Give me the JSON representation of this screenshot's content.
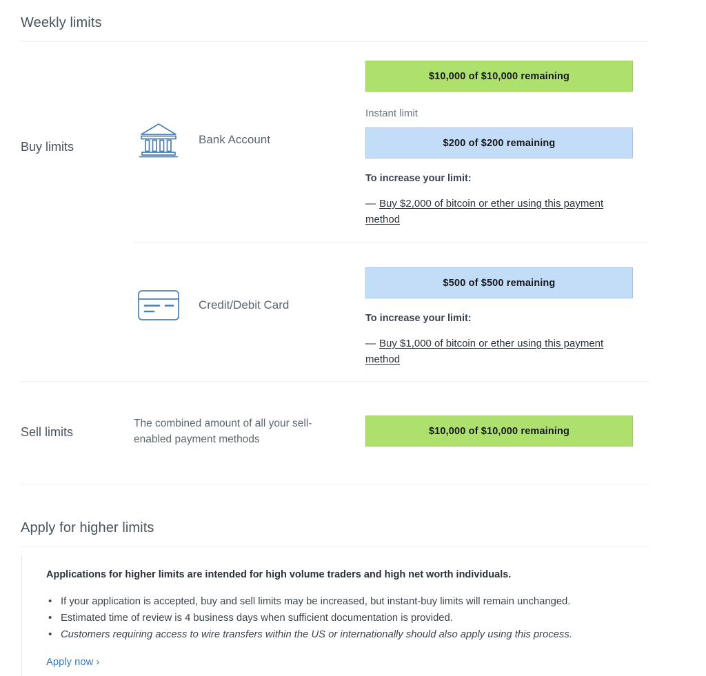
{
  "weekly": {
    "title": "Weekly limits",
    "buy": {
      "label": "Buy limits",
      "methods": [
        {
          "icon": "bank-icon",
          "name": "Bank Account",
          "primary_bar": {
            "text": "$10,000 of $10,000 remaining",
            "color": "#aee06d",
            "border": "#9dd258",
            "remaining": 10000,
            "total": 10000
          },
          "instant_label": "Instant limit",
          "instant_bar": {
            "text": "$200 of $200 remaining",
            "color": "#c3dcf8",
            "border": "#a6c5e8",
            "remaining": 200,
            "total": 200
          },
          "increase_title": "To increase your limit:",
          "increase_dash": "—",
          "increase_link": "Buy $2,000 of bitcoin or ether using this payment method"
        },
        {
          "icon": "credit-card-icon",
          "name": "Credit/Debit Card",
          "primary_bar": {
            "text": "$500 of $500 remaining",
            "color": "#c3dcf8",
            "border": "#a6c5e8",
            "remaining": 500,
            "total": 500
          },
          "increase_title": "To increase your limit:",
          "increase_dash": "—",
          "increase_link": "Buy $1,000 of bitcoin or ether using this payment method"
        }
      ]
    },
    "sell": {
      "label": "Sell limits",
      "description": "The combined amount of all your sell-enabled payment methods",
      "bar": {
        "text": "$10,000 of $10,000 remaining",
        "color": "#aee06d",
        "border": "#9dd258",
        "remaining": 10000,
        "total": 10000
      }
    }
  },
  "apply": {
    "title": "Apply for higher limits",
    "lead": "Applications for higher limits are intended for high volume traders and high net worth individuals.",
    "bullets": [
      "If your application is accepted, buy and sell limits may be increased, but instant-buy limits will remain unchanged.",
      "Estimated time of review is 4 business days when sufficient documentation is provided.",
      "Customers requiring access to wire transfers within the US or internationally should also apply using this process."
    ],
    "apply_link": "Apply now ›"
  },
  "colors": {
    "green": "#aee06d",
    "blue": "#c3dcf8",
    "link": "#2f7fd1",
    "icon_blue": "#4a7fb5",
    "divider": "#eceef0"
  }
}
